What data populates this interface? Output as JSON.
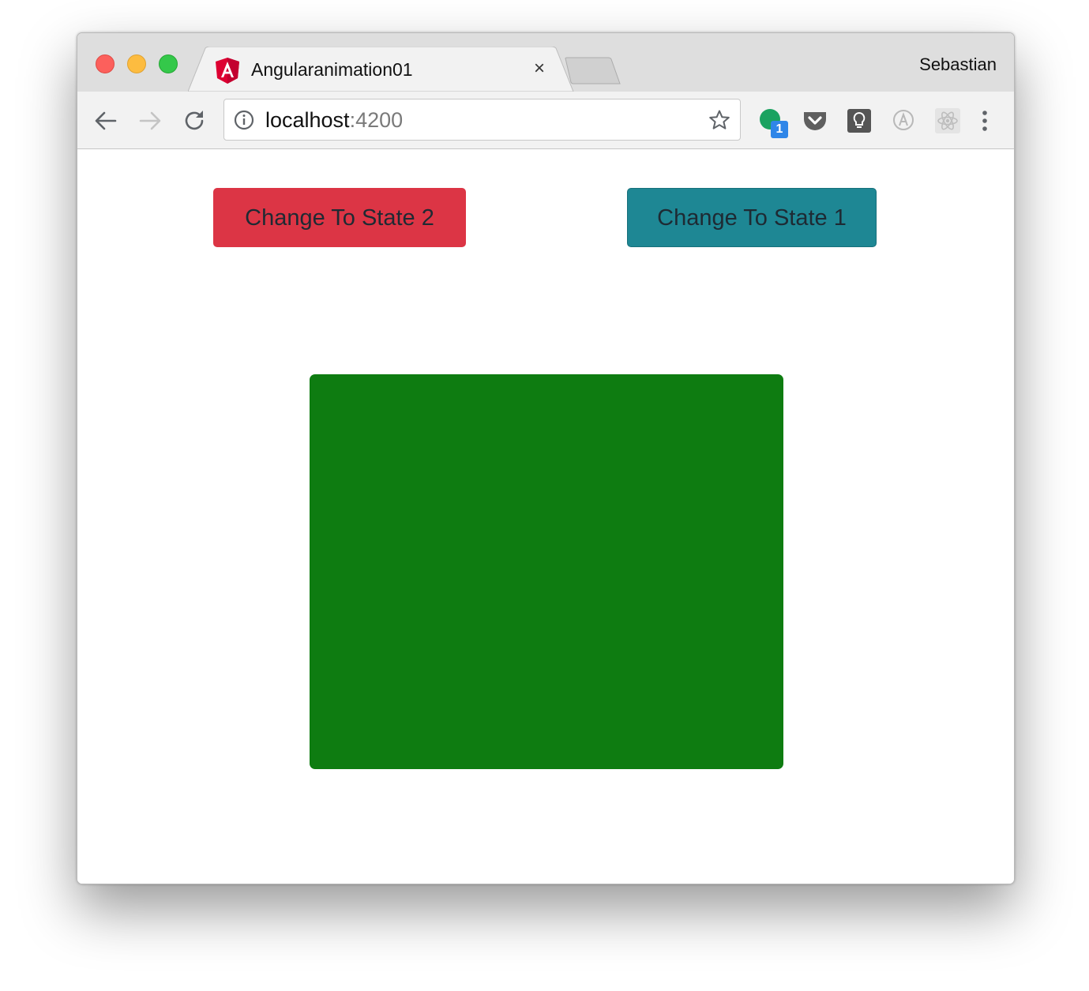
{
  "browser": {
    "tab": {
      "title": "Angularanimation01",
      "close_glyph": "×",
      "favicon": "angular-icon"
    },
    "profile_name": "Sebastian",
    "address_bar": {
      "host": "localhost",
      "port": ":4200"
    },
    "extensions": {
      "badge_count": "1",
      "icons": [
        "green-extension-icon",
        "pocket-icon",
        "lightbulb-icon",
        "a-circle-icon",
        "react-atom-icon",
        "more-menu-icon"
      ]
    }
  },
  "page": {
    "buttons": {
      "state2_label": "Change To State 2",
      "state1_label": "Change To State 1"
    }
  },
  "colors": {
    "state2_button": "#dc3545",
    "state1_button": "#1e8794",
    "animated_box": "#0e7c11"
  }
}
